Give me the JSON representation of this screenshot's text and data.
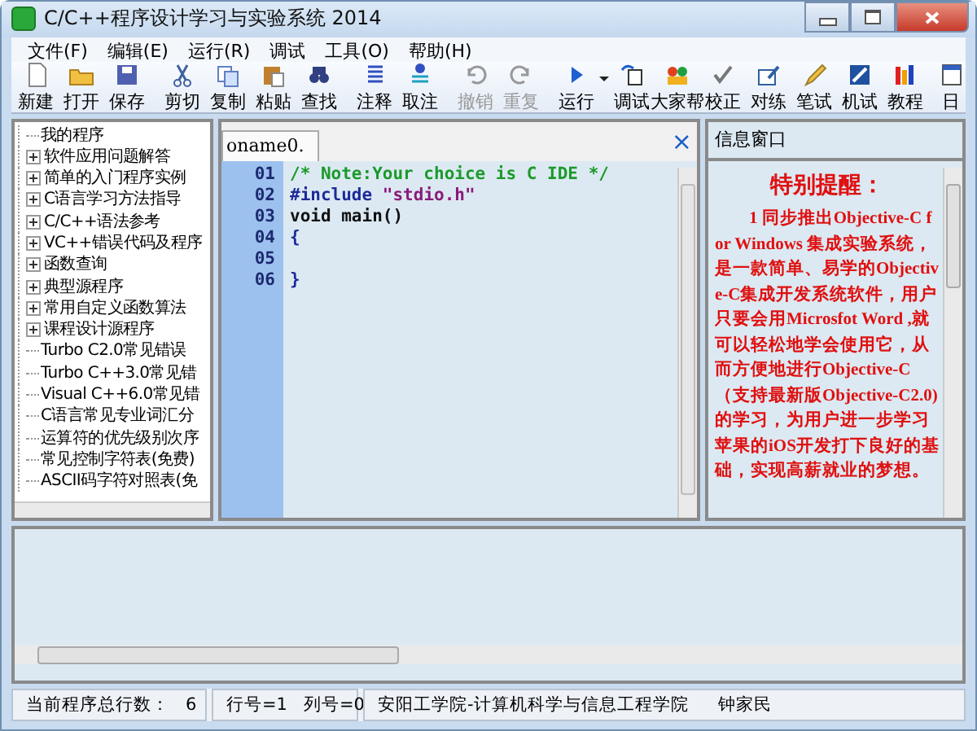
{
  "window": {
    "title": "C/C++程序设计学习与实验系统 2014"
  },
  "menu": [
    "文件(F)",
    "编辑(E)",
    "运行(R)",
    "调试",
    "工具(O)",
    "帮助(H)"
  ],
  "toolbar": [
    {
      "kind": "button",
      "label": "新建",
      "disabled": false
    },
    {
      "kind": "button",
      "label": "打开",
      "disabled": false
    },
    {
      "kind": "button",
      "label": "保存",
      "disabled": false
    },
    {
      "kind": "separator"
    },
    {
      "kind": "button",
      "label": "剪切",
      "disabled": false
    },
    {
      "kind": "button",
      "label": "复制",
      "disabled": false
    },
    {
      "kind": "button",
      "label": "粘贴",
      "disabled": false
    },
    {
      "kind": "button",
      "label": "查找",
      "disabled": false
    },
    {
      "kind": "separator"
    },
    {
      "kind": "button",
      "label": "注释",
      "disabled": false
    },
    {
      "kind": "button",
      "label": "取注",
      "disabled": false
    },
    {
      "kind": "separator"
    },
    {
      "kind": "button",
      "label": "撤销",
      "disabled": true
    },
    {
      "kind": "button",
      "label": "重复",
      "disabled": true
    },
    {
      "kind": "separator"
    },
    {
      "kind": "dropdown",
      "label": "运行",
      "disabled": false
    },
    {
      "kind": "button",
      "label": "调试",
      "disabled": false
    },
    {
      "kind": "button",
      "label": "大家帮",
      "disabled": false
    },
    {
      "kind": "button",
      "label": "校正",
      "disabled": false
    },
    {
      "kind": "button",
      "label": "对练",
      "disabled": false
    },
    {
      "kind": "button",
      "label": "笔试",
      "disabled": false
    },
    {
      "kind": "button",
      "label": "机试",
      "disabled": false
    },
    {
      "kind": "button",
      "label": "教程",
      "disabled": false
    },
    {
      "kind": "button",
      "label": "日",
      "disabled": false
    }
  ],
  "tree": [
    {
      "kind": "leaf",
      "label": "我的程序"
    },
    {
      "kind": "folder",
      "label": "软件应用问题解答"
    },
    {
      "kind": "folder",
      "label": "简单的入门程序实例"
    },
    {
      "kind": "folder",
      "label": "C语言学习方法指导"
    },
    {
      "kind": "folder",
      "label": "C/C++语法参考"
    },
    {
      "kind": "folder",
      "label": "VC++错误代码及程序"
    },
    {
      "kind": "folder",
      "label": "函数查询"
    },
    {
      "kind": "folder",
      "label": "典型源程序"
    },
    {
      "kind": "folder",
      "label": "常用自定义函数算法"
    },
    {
      "kind": "folder",
      "label": "课程设计源程序"
    },
    {
      "kind": "leaf",
      "label": "Turbo C2.0常见错误"
    },
    {
      "kind": "leaf",
      "label": "Turbo C++3.0常见错"
    },
    {
      "kind": "leaf",
      "label": "Visual C++6.0常见错"
    },
    {
      "kind": "leaf",
      "label": "C语言常见专业词汇分"
    },
    {
      "kind": "leaf",
      "label": "运算符的优先级别次序"
    },
    {
      "kind": "leaf",
      "label": "常见控制字符表(免费)"
    },
    {
      "kind": "leaf",
      "label": "ASCII码字符对照表(免"
    }
  ],
  "editor": {
    "tab": "oname0.",
    "close": "×",
    "lines": [
      {
        "number": "01",
        "tokens": [
          {
            "kind": "comment",
            "text": "/* Note:Your choice is C IDE */"
          }
        ]
      },
      {
        "number": "02",
        "tokens": [
          {
            "kind": "directive",
            "text": "#include "
          },
          {
            "kind": "string",
            "text": "\"stdio.h\""
          }
        ]
      },
      {
        "number": "03",
        "tokens": [
          {
            "kind": "plain",
            "text": "void main()"
          }
        ]
      },
      {
        "number": "04",
        "tokens": [
          {
            "kind": "brace",
            "text": "{"
          }
        ]
      },
      {
        "number": "05"
      },
      {
        "number": "06",
        "tokens": [
          {
            "kind": "brace",
            "text": "}"
          }
        ]
      }
    ]
  },
  "info": {
    "title": "信息窗口",
    "heading": "特别提醒：",
    "paragraph": "1 同步推出Objective-C for Windows 集成实验系统，是一款简单、易学的Objective-C集成开发系统软件，用户只要会用Microsfot Word ,就可以轻松地学会使用它，从而方便地进行Objective-C（支持最新版Objective-C2.0)的学习，为用户进一步学习苹果的iOS开发打下良好的基础，实现高薪就业的梦想。"
  },
  "status_bar": {
    "total_label": "当前程序总行数：",
    "total_value": "6",
    "line": "行号=1",
    "column": "列号=0",
    "school": "安阳工学院-计算机科学与信息工程学院",
    "author": "钟家民"
  }
}
